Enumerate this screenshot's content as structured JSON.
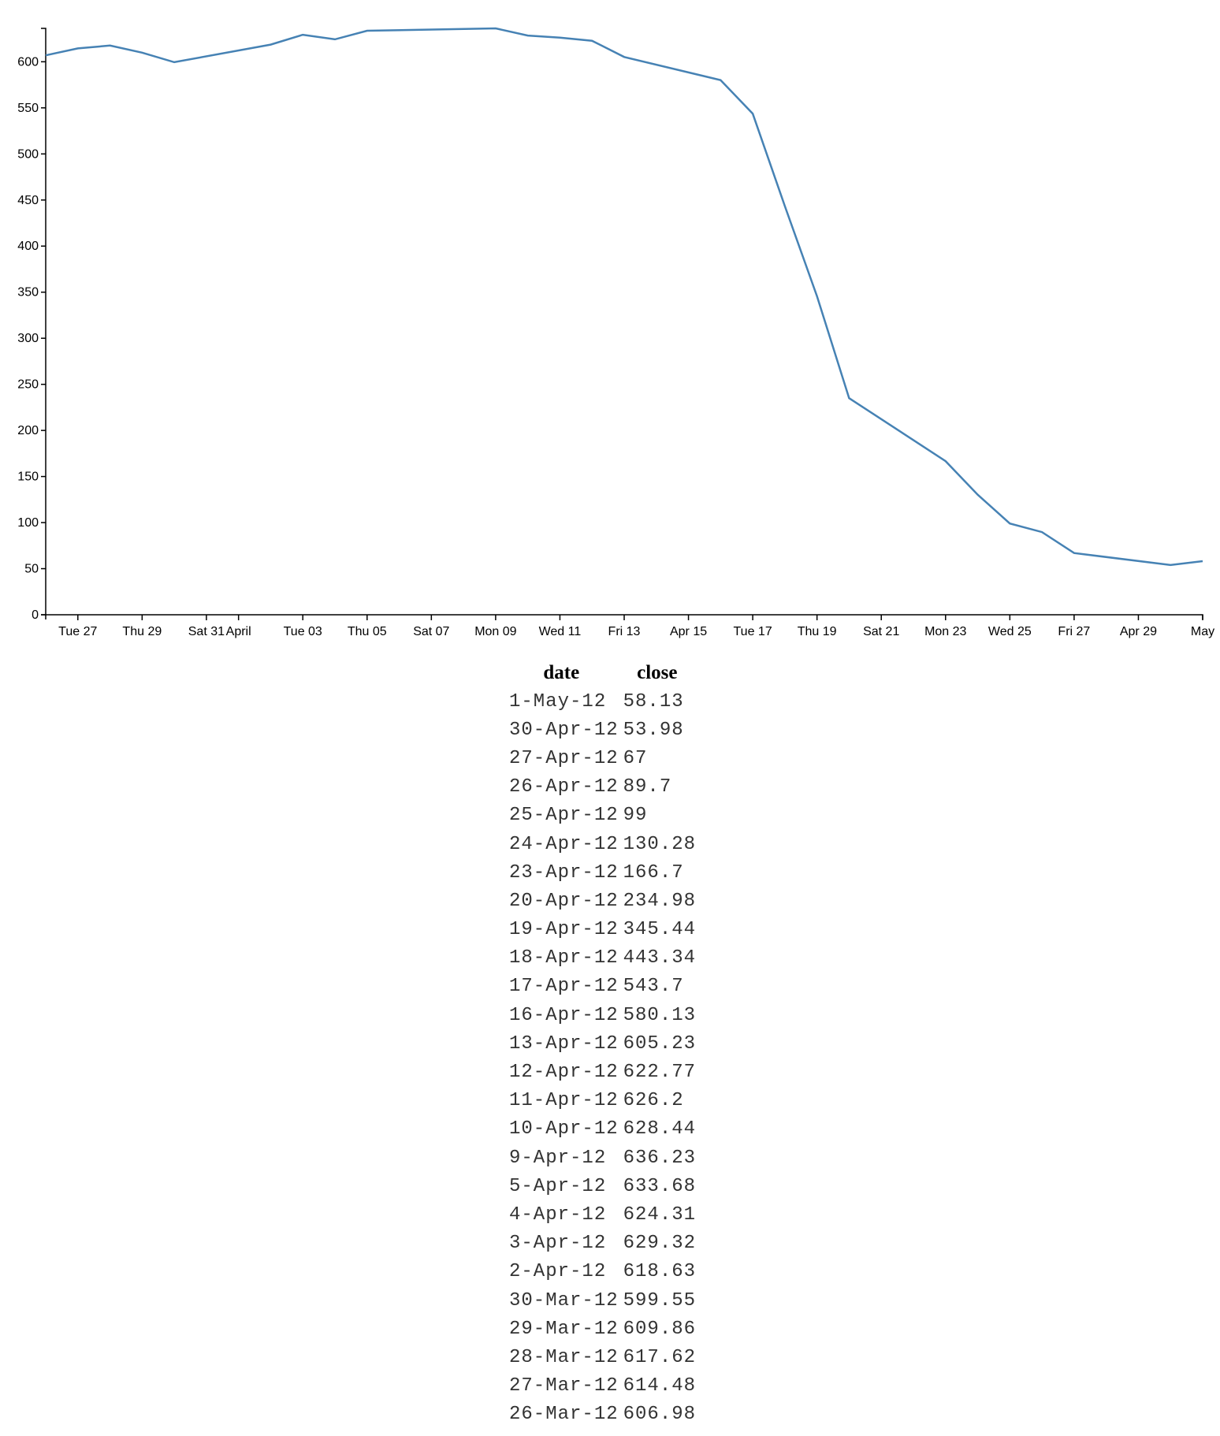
{
  "chart_data": {
    "type": "line",
    "xlabel": "",
    "ylabel": "",
    "color": "#4682b4",
    "ylim": [
      0,
      636.23
    ],
    "xlim": [
      "2012-03-26",
      "2012-05-01"
    ],
    "y_ticks": [
      "0",
      "50",
      "100",
      "150",
      "200",
      "250",
      "300",
      "350",
      "400",
      "450",
      "500",
      "550",
      "600"
    ],
    "x_ticks": [
      {
        "date": "2012-03-27",
        "label": "Tue 27"
      },
      {
        "date": "2012-03-29",
        "label": "Thu 29"
      },
      {
        "date": "2012-03-31",
        "label": "Sat 31"
      },
      {
        "date": "2012-04-01",
        "label": "April"
      },
      {
        "date": "2012-04-03",
        "label": "Tue 03"
      },
      {
        "date": "2012-04-05",
        "label": "Thu 05"
      },
      {
        "date": "2012-04-07",
        "label": "Sat 07"
      },
      {
        "date": "2012-04-09",
        "label": "Mon 09"
      },
      {
        "date": "2012-04-11",
        "label": "Wed 11"
      },
      {
        "date": "2012-04-13",
        "label": "Fri 13"
      },
      {
        "date": "2012-04-15",
        "label": "Apr 15"
      },
      {
        "date": "2012-04-17",
        "label": "Tue 17"
      },
      {
        "date": "2012-04-19",
        "label": "Thu 19"
      },
      {
        "date": "2012-04-21",
        "label": "Sat 21"
      },
      {
        "date": "2012-04-23",
        "label": "Mon 23"
      },
      {
        "date": "2012-04-25",
        "label": "Wed 25"
      },
      {
        "date": "2012-04-27",
        "label": "Fri 27"
      },
      {
        "date": "2012-04-29",
        "label": "Apr 29"
      },
      {
        "date": "2012-05-01",
        "label": "May"
      }
    ],
    "grid": false
  },
  "table": {
    "headers": [
      "date",
      "close"
    ],
    "rows": [
      [
        "1-May-12",
        "58.13"
      ],
      [
        "30-Apr-12",
        "53.98"
      ],
      [
        "27-Apr-12",
        "67"
      ],
      [
        "26-Apr-12",
        "89.7"
      ],
      [
        "25-Apr-12",
        "99"
      ],
      [
        "24-Apr-12",
        "130.28"
      ],
      [
        "23-Apr-12",
        "166.7"
      ],
      [
        "20-Apr-12",
        "234.98"
      ],
      [
        "19-Apr-12",
        "345.44"
      ],
      [
        "18-Apr-12",
        "443.34"
      ],
      [
        "17-Apr-12",
        "543.7"
      ],
      [
        "16-Apr-12",
        "580.13"
      ],
      [
        "13-Apr-12",
        "605.23"
      ],
      [
        "12-Apr-12",
        "622.77"
      ],
      [
        "11-Apr-12",
        "626.2"
      ],
      [
        "10-Apr-12",
        "628.44"
      ],
      [
        "9-Apr-12",
        "636.23"
      ],
      [
        "5-Apr-12",
        "633.68"
      ],
      [
        "4-Apr-12",
        "624.31"
      ],
      [
        "3-Apr-12",
        "629.32"
      ],
      [
        "2-Apr-12",
        "618.63"
      ],
      [
        "30-Mar-12",
        "599.55"
      ],
      [
        "29-Mar-12",
        "609.86"
      ],
      [
        "28-Mar-12",
        "617.62"
      ],
      [
        "27-Mar-12",
        "614.48"
      ],
      [
        "26-Mar-12",
        "606.98"
      ]
    ]
  }
}
